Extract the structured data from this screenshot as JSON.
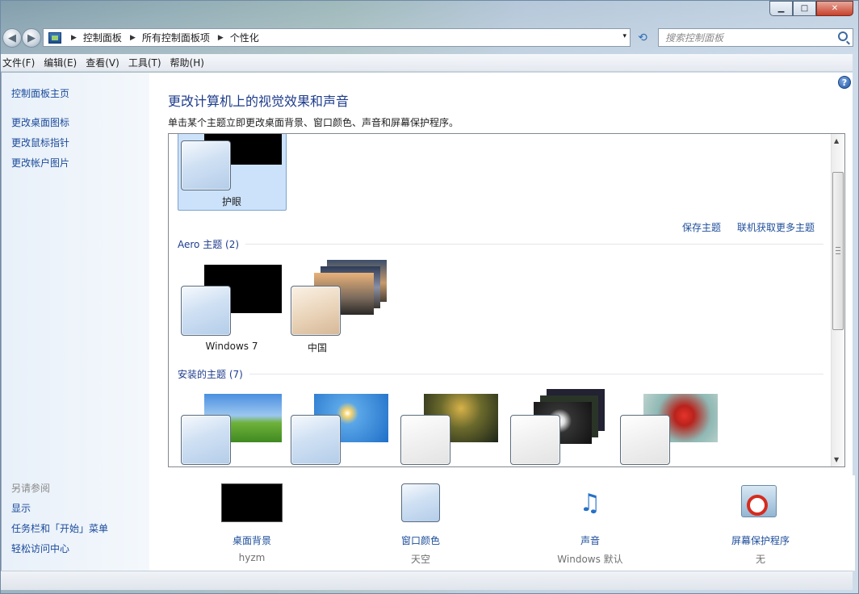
{
  "window": {
    "min": "▁",
    "max": "□",
    "close": "✕"
  },
  "nav": {
    "back": "◀",
    "forward": "▶"
  },
  "address": {
    "crumbs": [
      "控制面板",
      "所有控制面板项",
      "个性化"
    ],
    "dropdown": "▾",
    "refresh": "⟲"
  },
  "search": {
    "placeholder": "搜索控制面板"
  },
  "menu": [
    "文件(F)",
    "编辑(E)",
    "查看(V)",
    "工具(T)",
    "帮助(H)"
  ],
  "sidebar": {
    "home": "控制面板主页",
    "links": [
      "更改桌面图标",
      "更改鼠标指针",
      "更改帐户图片"
    ],
    "see_also_header": "另请参阅",
    "see_also": [
      "显示",
      "任务栏和「开始」菜单",
      "轻松访问中心"
    ]
  },
  "help": "?",
  "main": {
    "title": "更改计算机上的视觉效果和声音",
    "description": "单击某个主题立即更改桌面背景、窗口颜色、声音和屏幕保护程序。",
    "my_theme": "护眼",
    "save_theme": "保存主题",
    "get_more": "联机获取更多主题",
    "aero_header": "Aero 主题 (2)",
    "aero": [
      "Windows 7",
      "中国"
    ],
    "installed_header": "安装的主题 (7)"
  },
  "scroll": {
    "up": "▲",
    "down": "▼"
  },
  "bottom": [
    {
      "title": "桌面背景",
      "value": "hyzm"
    },
    {
      "title": "窗口颜色",
      "value": "天空"
    },
    {
      "title": "声音",
      "value": "Windows 默认"
    },
    {
      "title": "屏幕保护程序",
      "value": "无"
    }
  ]
}
